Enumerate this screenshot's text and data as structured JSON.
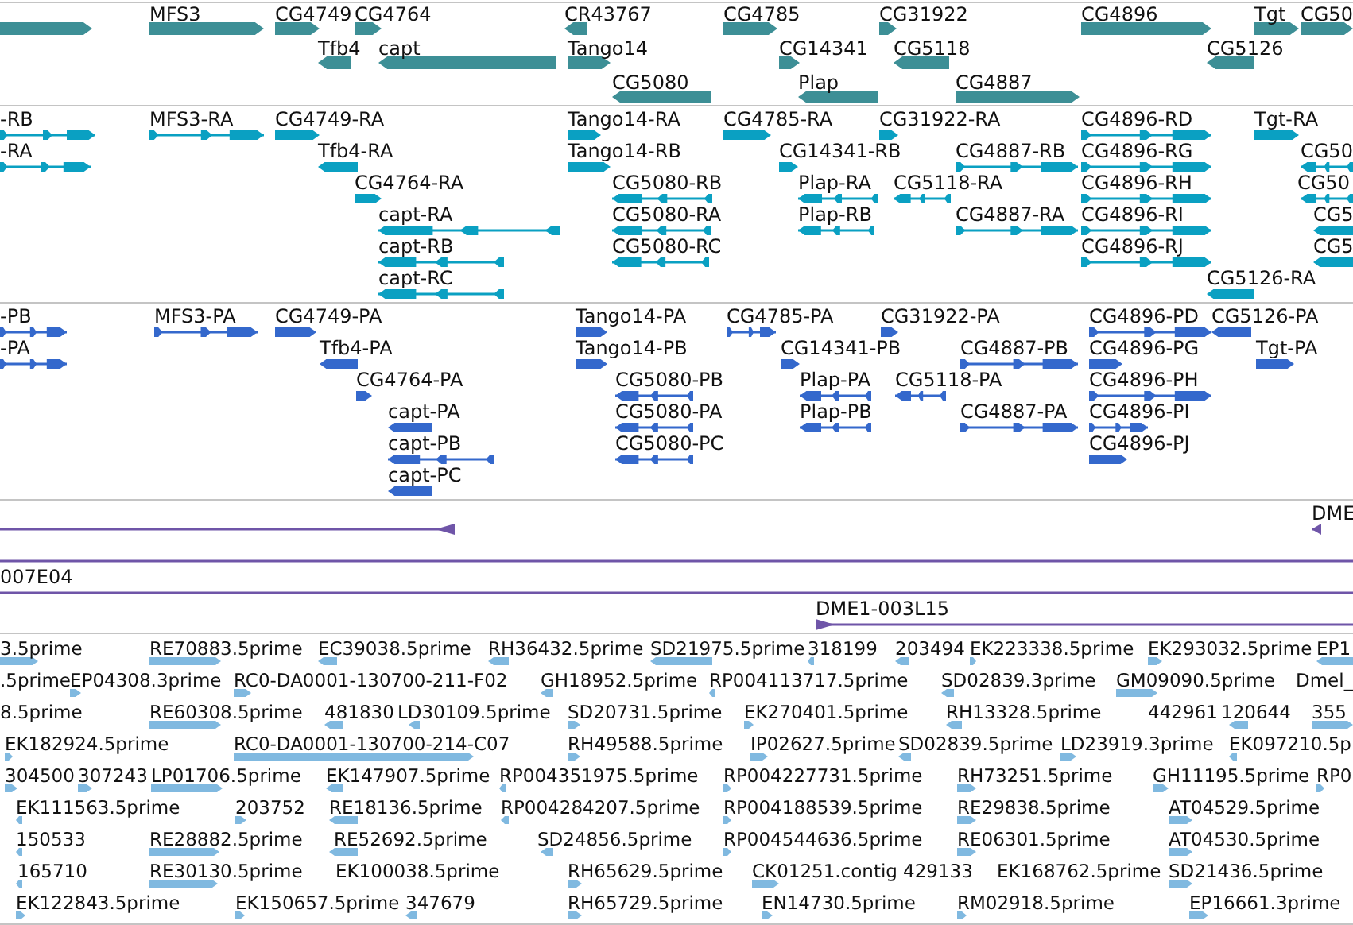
{
  "tracks": [
    {
      "kind": "gene",
      "rows": [
        {
          "features": [
            {
              "reverse": false
            },
            {
              "label": "MFS3",
              "reverse": false
            },
            {
              "label": "CG4749",
              "reverse": false
            },
            {
              "label": "CG4764",
              "reverse": false
            },
            {
              "label": "CR43767",
              "reverse": true
            },
            {
              "label": "CG4785",
              "reverse": false
            },
            {
              "label": "CG31922",
              "reverse": false
            },
            {
              "label": "CG4896",
              "reverse": false
            },
            {
              "label": "Tgt",
              "reverse": false
            },
            {
              "label": "CG50",
              "reverse": false
            }
          ]
        },
        {
          "features": [
            {
              "label": "Tfb4",
              "reverse": true
            },
            {
              "label": "capt",
              "reverse": true
            },
            {
              "label": "Tango14",
              "reverse": false
            },
            {
              "label": "CG14341",
              "reverse": false
            },
            {
              "label": "CG5118",
              "reverse": true
            },
            {
              "label": "CG5126",
              "reverse": true
            }
          ]
        },
        {
          "features": [
            {
              "label": "CG5080",
              "reverse": true
            },
            {
              "label": "Plap",
              "reverse": true
            },
            {
              "label": "CG4887",
              "reverse": false
            }
          ]
        }
      ]
    },
    {
      "kind": "transcript",
      "rows": [
        {
          "features": [
            {
              "label": "-RB",
              "reverse": false
            },
            {
              "label": "MFS3-RA",
              "reverse": false
            },
            {
              "label": "CG4749-RA",
              "reverse": false
            },
            {
              "label": "Tango14-RA",
              "reverse": false
            },
            {
              "label": "CG4785-RA",
              "reverse": false
            },
            {
              "label": "CG31922-RA",
              "reverse": false
            },
            {
              "label": "CG4896-RD",
              "reverse": false
            },
            {
              "label": "Tgt-RA",
              "reverse": false
            }
          ]
        },
        {
          "features": [
            {
              "label": "-RA",
              "reverse": false
            },
            {
              "label": "Tfb4-RA",
              "reverse": true
            },
            {
              "label": "Tango14-RB",
              "reverse": false
            },
            {
              "label": "CG14341-RB",
              "reverse": false
            },
            {
              "label": "CG4887-RB",
              "reverse": false
            },
            {
              "label": "CG4896-RG",
              "reverse": false
            },
            {
              "label": "CG50",
              "reverse": true
            }
          ]
        },
        {
          "features": [
            {
              "label": "CG4764-RA",
              "reverse": false
            },
            {
              "label": "CG5080-RB",
              "reverse": true
            },
            {
              "label": "Plap-RA",
              "reverse": true
            },
            {
              "label": "CG5118-RA",
              "reverse": true
            },
            {
              "label": "CG4896-RH",
              "reverse": false
            },
            {
              "label": "CG50",
              "reverse": true
            }
          ]
        },
        {
          "features": [
            {
              "label": "capt-RA",
              "reverse": true
            },
            {
              "label": "CG5080-RA",
              "reverse": true
            },
            {
              "label": "Plap-RB",
              "reverse": true
            },
            {
              "label": "CG4887-RA",
              "reverse": false
            },
            {
              "label": "CG4896-RI",
              "reverse": false
            },
            {
              "label": "CG5",
              "reverse": true
            }
          ]
        },
        {
          "features": [
            {
              "label": "capt-RB",
              "reverse": true
            },
            {
              "label": "CG5080-RC",
              "reverse": true
            },
            {
              "label": "CG4896-RJ",
              "reverse": false
            },
            {
              "label": "CG5",
              "reverse": true
            }
          ]
        },
        {
          "features": [
            {
              "label": "capt-RC",
              "reverse": true
            },
            {
              "label": "CG5126-RA",
              "reverse": true
            }
          ]
        }
      ]
    },
    {
      "kind": "protein",
      "rows": [
        {
          "features": [
            {
              "label": "-PB",
              "reverse": false
            },
            {
              "label": "MFS3-PA",
              "reverse": false
            },
            {
              "label": "CG4749-PA",
              "reverse": false
            },
            {
              "label": "Tango14-PA",
              "reverse": false
            },
            {
              "label": "CG4785-PA",
              "reverse": false
            },
            {
              "label": "CG31922-PA",
              "reverse": false
            },
            {
              "label": "CG4896-PD",
              "reverse": false
            },
            {
              "label": "CG5126-PA",
              "reverse": true
            }
          ]
        },
        {
          "features": [
            {
              "label": "-PA",
              "reverse": false
            },
            {
              "label": "Tfb4-PA",
              "reverse": true
            },
            {
              "label": "Tango14-PB",
              "reverse": false
            },
            {
              "label": "CG14341-PB",
              "reverse": false
            },
            {
              "label": "CG4887-PB",
              "reverse": false
            },
            {
              "label": "CG4896-PG",
              "reverse": false
            },
            {
              "label": "Tgt-PA",
              "reverse": false
            }
          ]
        },
        {
          "features": [
            {
              "label": "CG4764-PA",
              "reverse": false
            },
            {
              "label": "CG5080-PB",
              "reverse": true
            },
            {
              "label": "Plap-PA",
              "reverse": true
            },
            {
              "label": "CG5118-PA",
              "reverse": true
            },
            {
              "label": "CG4896-PH",
              "reverse": false
            }
          ]
        },
        {
          "features": [
            {
              "label": "capt-PA",
              "reverse": true
            },
            {
              "label": "CG5080-PA",
              "reverse": true
            },
            {
              "label": "Plap-PB",
              "reverse": true
            },
            {
              "label": "CG4887-PA",
              "reverse": false
            },
            {
              "label": "CG4896-PI",
              "reverse": false
            }
          ]
        },
        {
          "features": [
            {
              "label": "capt-PB",
              "reverse": true
            },
            {
              "label": "CG5080-PC",
              "reverse": true
            },
            {
              "label": "CG4896-PJ",
              "reverse": false
            }
          ]
        },
        {
          "features": [
            {
              "label": "capt-PC",
              "reverse": true
            }
          ]
        }
      ]
    },
    {
      "kind": "clone",
      "rows": [
        {
          "features": [
            {
              "reverse": true
            },
            {
              "label": "DME",
              "reverse": true
            }
          ]
        },
        {
          "features": [
            {
              "headless": true
            }
          ]
        },
        {
          "features": [
            {
              "label": "007E04",
              "headless": true
            }
          ]
        },
        {
          "features": [
            {
              "label": "DME1-003L15",
              "reverse": false
            }
          ]
        }
      ]
    },
    {
      "kind": "est",
      "rows": [
        {
          "features": [
            {
              "label": "3.5prime",
              "reverse": false
            },
            {
              "label": "RE70883.5prime",
              "reverse": false
            },
            {
              "label": "EC39038.5prime",
              "reverse": true
            },
            {
              "label": "RH36432.5prime",
              "reverse": true
            },
            {
              "label": "SD21975.5prime",
              "reverse": true
            },
            {
              "label": "318199",
              "reverse": true
            },
            {
              "label": "203494",
              "reverse": true
            },
            {
              "label": "EK223338.5prime",
              "reverse": false
            },
            {
              "label": "EK293032.5prime",
              "reverse": false
            },
            {
              "label": "EP1",
              "reverse": true
            }
          ]
        },
        {
          "features": [
            {
              "label": ".5prime"
            },
            {
              "label": "EP04308.3prime",
              "reverse": false
            },
            {
              "label": "RC0-DA0001-130700-211-F02",
              "reverse": false
            },
            {
              "label": "GH18952.5prime",
              "reverse": true
            },
            {
              "label": "RP004113717.5prime",
              "reverse": true
            },
            {
              "label": "SD02839.3prime",
              "reverse": true
            },
            {
              "label": "GM09090.5prime",
              "reverse": false
            },
            {
              "label": "Dmel_"
            }
          ]
        },
        {
          "features": [
            {
              "label": "8.5prime"
            },
            {
              "label": "RE60308.5prime",
              "reverse": false
            },
            {
              "label": "481830",
              "reverse": true
            },
            {
              "label": "LD30109.5prime",
              "reverse": true
            },
            {
              "label": "SD20731.5prime",
              "reverse": false
            },
            {
              "label": "EK270401.5prime",
              "reverse": false
            },
            {
              "label": "RH13328.5prime",
              "reverse": true
            },
            {
              "label": "442961"
            },
            {
              "label": "120644",
              "reverse": true
            },
            {
              "label": "355",
              "reverse": false
            }
          ]
        },
        {
          "features": [
            {
              "label": "EK182924.5prime",
              "reverse": false
            },
            {
              "label": "RC0-DA0001-130700-214-C07",
              "reverse": false
            },
            {
              "label": "RH49588.5prime",
              "reverse": false
            },
            {
              "label": "IP02627.5prime",
              "reverse": false
            },
            {
              "label": "SD02839.5prime",
              "reverse": true
            },
            {
              "label": "LD23919.3prime",
              "reverse": false
            },
            {
              "label": "EK097210.5p",
              "reverse": true
            }
          ]
        },
        {
          "features": [
            {
              "label": "304500",
              "reverse": false
            },
            {
              "label": "307243",
              "reverse": false
            },
            {
              "label": "LP01706.5prime",
              "reverse": false
            },
            {
              "label": "EK147907.5prime",
              "reverse": true
            },
            {
              "label": "RP004351975.5prime",
              "reverse": true
            },
            {
              "label": "RP004227731.5prime",
              "reverse": false
            },
            {
              "label": "RH73251.5prime",
              "reverse": false
            },
            {
              "label": "GH11195.5prime",
              "reverse": false
            },
            {
              "label": "RP0",
              "reverse": false
            }
          ]
        },
        {
          "features": [
            {
              "label": "EK111563.5prime",
              "reverse": true
            },
            {
              "label": "203752",
              "reverse": false
            },
            {
              "label": "RE18136.5prime",
              "reverse": true
            },
            {
              "label": "RP004284207.5prime",
              "reverse": true
            },
            {
              "label": "RP004188539.5prime",
              "reverse": false
            },
            {
              "label": "RE29838.5prime",
              "reverse": false
            },
            {
              "label": "AT04529.5prime",
              "reverse": false
            }
          ]
        },
        {
          "features": [
            {
              "label": "150533",
              "reverse": true
            },
            {
              "label": "RE28882.5prime",
              "reverse": false
            },
            {
              "label": "RE52692.5prime",
              "reverse": true
            },
            {
              "label": "SD24856.5prime",
              "reverse": true
            },
            {
              "label": "RP004544636.5prime",
              "reverse": false
            },
            {
              "label": "RE06301.5prime",
              "reverse": false
            },
            {
              "label": "AT04530.5prime",
              "reverse": false
            }
          ]
        },
        {
          "features": [
            {
              "label": "165710",
              "reverse": true
            },
            {
              "label": "RE30130.5prime",
              "reverse": false
            },
            {
              "label": "EK100038.5prime"
            },
            {
              "label": "RH65629.5prime",
              "reverse": false
            },
            {
              "label": "CK01251.contig",
              "reverse": false
            },
            {
              "label": "429133"
            },
            {
              "label": "EK168762.5prime"
            },
            {
              "label": "SD21436.5prime",
              "reverse": false
            }
          ]
        },
        {
          "features": [
            {
              "label": "EK122843.5prime",
              "reverse": false
            },
            {
              "label": "EK150657.5prime",
              "reverse": false
            },
            {
              "label": "347679",
              "reverse": true
            },
            {
              "label": "RH65729.5prime",
              "reverse": false
            },
            {
              "label": "EN14730.5prime",
              "reverse": false
            },
            {
              "label": "RM02918.5prime",
              "reverse": false
            },
            {
              "label": "EP16661.3prime",
              "reverse": false
            }
          ]
        }
      ]
    }
  ]
}
